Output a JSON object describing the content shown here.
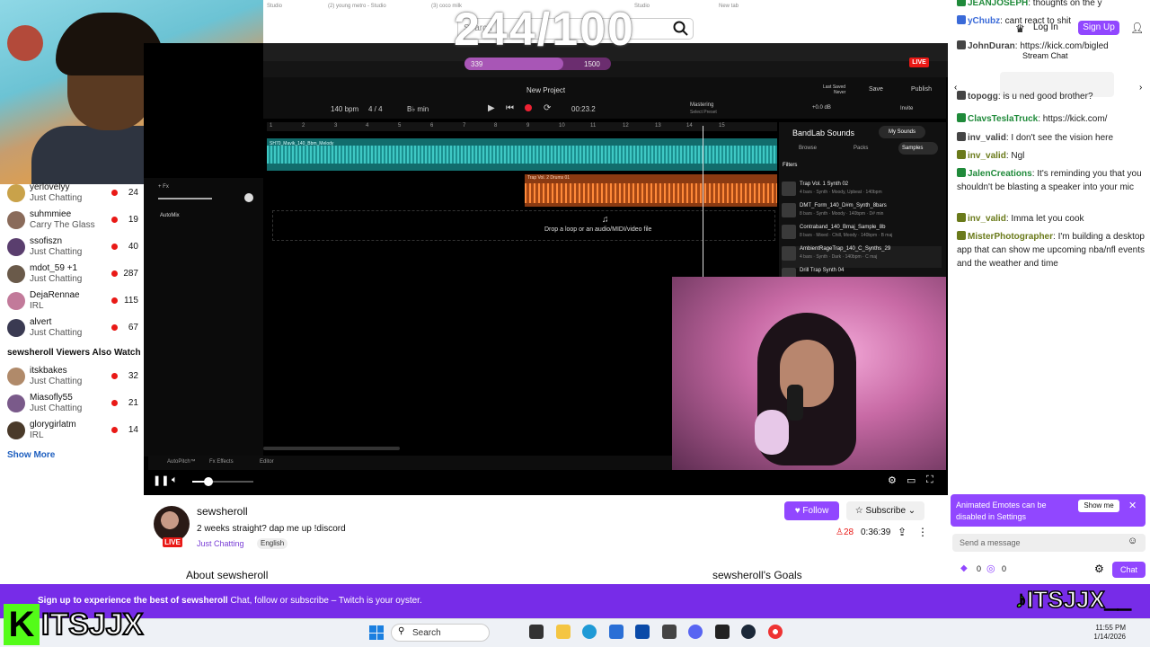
{
  "sub_goal_count": "244/100",
  "search": {
    "placeholder": "Search"
  },
  "top_actions": {
    "login": "Log In",
    "signup": "Sign Up"
  },
  "bandlab": {
    "tabs": [
      "Studio",
      "(2) young metro - Studio",
      "(3) coco milk",
      "Studio",
      "New tab"
    ],
    "project_title": "New Project",
    "bpm": "140 bpm",
    "time_sig": "4 / 4",
    "key": "B♭ min",
    "time": "00:23.2",
    "mastering": "Mastering",
    "mastering_sub": "Select Preset",
    "db": "+0.0 dB",
    "last_saved": "Last Saved",
    "never": "Never",
    "save": "Save",
    "publish": "Publish",
    "invite": "Invite",
    "ruler": [
      "1",
      "2",
      "3",
      "4",
      "5",
      "6",
      "7",
      "8",
      "9",
      "10",
      "11",
      "12",
      "13",
      "14",
      "15"
    ],
    "track1_label": "SH70_Mavik_140_Bbm_Melody",
    "track2_label": "Trap Vol. 2 Drums 01",
    "drop_text": "Drop a loop or an audio/MIDI/video file",
    "fx": "+ Fx",
    "automix": "AutoMix",
    "bottom": [
      "AutoPitch™",
      "Fx Effects",
      "Editor"
    ],
    "sounds_title": "BandLab Sounds",
    "my_sounds": "My Sounds",
    "sound_tabs": [
      "Browse",
      "Packs",
      "Samples"
    ],
    "filters": "Filters",
    "samples": [
      {
        "name": "Trap Vol. 1 Synth 02",
        "meta": "4 bars · Synth · Moody, Upbeat · 140bpm"
      },
      {
        "name": "DMT_Form_140_D#m_Synth_8bars",
        "meta": "8 bars · Synth · Moody · 140bpm · D# min"
      },
      {
        "name": "Contraband_140_Bmaj_Sample_8b",
        "meta": "8 bars · Mixed · Chill, Moody · 140bpm · B maj"
      },
      {
        "name": "AmbientRageTrap_140_C_Synths_29",
        "meta": "4 bars · Synth · Dark · 140bpm · C maj"
      },
      {
        "name": "Drill Trap Synth 04",
        "meta": ""
      }
    ],
    "goal_left": "339",
    "goal_right": "1500",
    "live": "LIVE"
  },
  "sidebar": {
    "channels": [
      {
        "name": "yerlovelyy",
        "category": "Just Chatting",
        "viewers": "24",
        "color": "#c9a24a"
      },
      {
        "name": "suhmmiee",
        "category": "Carry The Glass",
        "viewers": "19",
        "color": "#8a6b5a"
      },
      {
        "name": "ssofiszn",
        "category": "Just Chatting",
        "viewers": "40",
        "color": "#5a3e6e"
      },
      {
        "name": "mdot_59 +1",
        "category": "Just Chatting",
        "viewers": "287",
        "color": "#6a5a4a"
      },
      {
        "name": "DejaRennae",
        "category": "IRL",
        "viewers": "115",
        "color": "#c27a9a"
      },
      {
        "name": "alvert",
        "category": "Just Chatting",
        "viewers": "67",
        "color": "#3a3a52"
      }
    ],
    "also_watch_header": "sewsheroll Viewers Also Watch",
    "also_watch": [
      {
        "name": "itskbakes",
        "category": "Just Chatting",
        "viewers": "32",
        "color": "#b08a6a"
      },
      {
        "name": "Miasofly55",
        "category": "Just Chatting",
        "viewers": "21",
        "color": "#7a5a8a"
      },
      {
        "name": "glorygirlatm",
        "category": "IRL",
        "viewers": "14",
        "color": "#4a3a2a"
      }
    ],
    "show_more": "Show More"
  },
  "channel": {
    "name": "sewsheroll",
    "title": "2 weeks straight? dap me up !discord",
    "category": "Just Chatting",
    "language": "English",
    "live": "LIVE",
    "follow": "Follow",
    "subscribe": "Subscribe",
    "viewers": "28",
    "uptime": "0:36:39",
    "about": "About sewsheroll",
    "goals": "sewsheroll's Goals"
  },
  "chat": {
    "stream_chat": "Stream Chat",
    "messages": [
      {
        "user": "JEANJOSEPH",
        "text": ": thoughts on the y",
        "color": "#1f8a3a"
      },
      {
        "user": "yChubz",
        "text": ": cant react to shit",
        "color": "#3a6ad8"
      },
      {
        "user": "JohnDuran",
        "text": ": https://kick.com/bigled",
        "color": "#444"
      },
      {
        "user": "topogg",
        "text": ": is u ned good brother?",
        "color": "#444"
      },
      {
        "user": "ClavsTeslaTruck",
        "text": ": https://kick.com/",
        "color": "#1f8a3a"
      },
      {
        "user": "inv_valid",
        "text": ": I don't see the vision here",
        "color": "#444"
      },
      {
        "user": "inv_valid",
        "text": ": Ngl",
        "color": "#6a7a1a"
      },
      {
        "user": "JalenCreations",
        "text": ": It's reminding you that you shouldn't be blasting a speaker into your mic",
        "color": "#1f8a3a"
      },
      {
        "user": "inv_valid",
        "text": ": Imma let you cook",
        "color": "#6a7a1a"
      },
      {
        "user": "MisterPhotographer",
        "text": ": I'm building a desktop app that can show me upcoming nba/nfl events and the weather and time",
        "color": "#6a7a1a"
      }
    ],
    "emote_notice": "Animated Emotes can be disabled in Settings",
    "show_me": "Show me",
    "placeholder": "Send a message",
    "send": "Chat",
    "points1": "0",
    "points2": "0"
  },
  "banner": {
    "bold": "Sign up to experience the best of sewsheroll",
    "rest": " Chat, follow or subscribe – Twitch is your oyster.",
    "logo_left": "ITSJJX",
    "logo_right": "ITSJJX__"
  },
  "taskbar": {
    "search": "Search",
    "time": "11:55 PM",
    "date": "1/14/2026"
  }
}
